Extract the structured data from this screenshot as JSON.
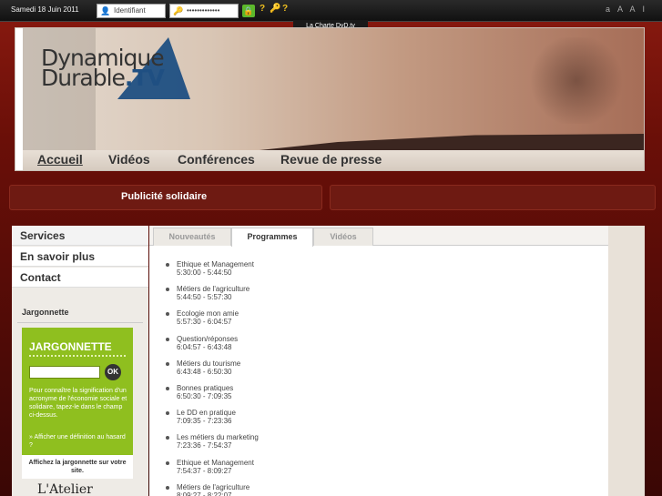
{
  "topbar": {
    "date": "Samedi 18 Juin 2011",
    "login_placeholder": "Identifiant",
    "password_placeholder": "•••••••••••••",
    "font_size_controls": "a A A I",
    "charte_tab": "La Charte DyD.tv"
  },
  "logo": {
    "line1": "Dynamique",
    "line2": "Durable",
    "suffix": ".TV"
  },
  "nav": {
    "items": [
      {
        "label": "Accueil",
        "active": true
      },
      {
        "label": "Vidéos",
        "active": false
      },
      {
        "label": "Conférences",
        "active": false
      },
      {
        "label": "Revue de presse",
        "active": false
      }
    ]
  },
  "publicite": {
    "label": "Publicité solidaire"
  },
  "sidebar": {
    "items": [
      {
        "label": "Services"
      },
      {
        "label": "En savoir plus"
      },
      {
        "label": "Contact"
      }
    ],
    "section_title": "Jargonnette",
    "jargonnette": {
      "title": "JARGONNETTE",
      "ok_label": "OK",
      "description": "Pour connaître la signification d'un acronyme de l'économie sociale et solidaire, tapez-le dans le champ ci-dessus.",
      "random_link": "» Afficher une définition au hasard ?",
      "share": "Affichez la jargonnette sur votre site."
    },
    "atelier": "L'Atelier"
  },
  "main": {
    "tabs": [
      {
        "label": "Nouveautés",
        "active": false
      },
      {
        "label": "Programmes",
        "active": true
      },
      {
        "label": "Vidéos",
        "active": false
      }
    ],
    "programmes": [
      {
        "title": "Ethique et Management",
        "time": "5:30:00 - 5:44:50"
      },
      {
        "title": "Métiers de l'agriculture",
        "time": "5:44:50 - 5:57:30"
      },
      {
        "title": "Ecologie mon amie",
        "time": "5:57:30 - 6:04:57"
      },
      {
        "title": "Question/réponses",
        "time": "6:04:57 - 6:43:48"
      },
      {
        "title": "Métiers du tourisme",
        "time": "6:43:48 - 6:50:30"
      },
      {
        "title": "Bonnes pratiques",
        "time": "6:50:30 - 7:09:35"
      },
      {
        "title": "Le DD en pratique",
        "time": "7:09:35 - 7:23:36"
      },
      {
        "title": "Les métiers du marketing",
        "time": "7:23:36 - 7:54:37"
      },
      {
        "title": "Ethique et Management",
        "time": "7:54:37 - 8:09:27"
      },
      {
        "title": "Métiers de l'agriculture",
        "time": "8:09:27 - 8:22:07"
      }
    ]
  }
}
